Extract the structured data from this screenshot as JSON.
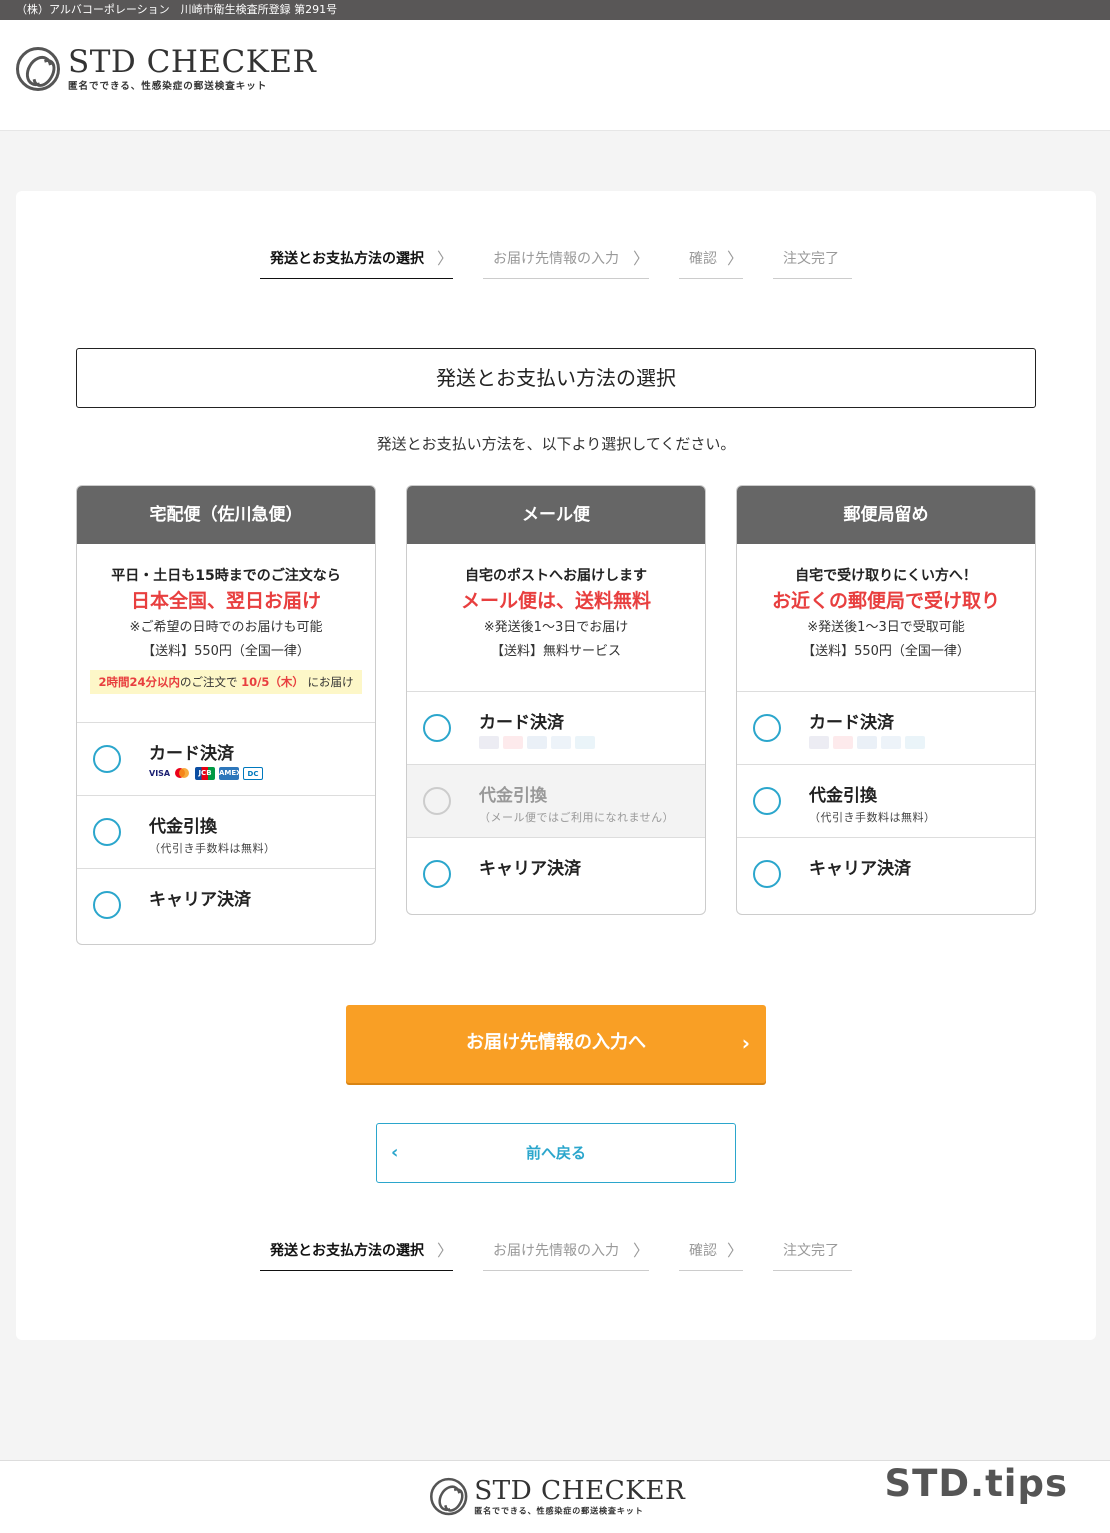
{
  "topbar": {
    "text": "（株）アルバコーポレーション　川崎市衛生検査所登録 第291号"
  },
  "brand": {
    "name": "STD CHECKER",
    "tagline": "匿名でできる、性感染症の郵送検査キット"
  },
  "steps": [
    {
      "label": "発送とお支払方法の選択",
      "active": true
    },
    {
      "label": "お届け先情報の入力",
      "active": false
    },
    {
      "label": "確認",
      "active": false
    },
    {
      "label": "注文完了",
      "active": false
    }
  ],
  "section": {
    "title": "発送とお支払い方法の選択",
    "lead": "発送とお支払い方法を、以下より選択してください。"
  },
  "plans": [
    {
      "title": "宅配便（佐川急便）",
      "line1": "平日・土日も15時までのご注文なら",
      "line2": "日本全国、翌日お届け",
      "line3": "※ご希望の日時でのお届けも可能",
      "line4": "【送料】550円（全国一律）",
      "promo": {
        "prefix": "2時間24分以内",
        "mid": "のご注文で",
        "date": "10/5（木）",
        "suffix": "にお届け"
      },
      "options": [
        {
          "label": "カード決済",
          "note": "",
          "cards": true
        },
        {
          "label": "代金引換",
          "note": "（代引き手数料は無料）"
        },
        {
          "label": "キャリア決済",
          "note": ""
        }
      ]
    },
    {
      "title": "メール便",
      "line1": "自宅のポストへお届けします",
      "line2": "メール便は、送料無料",
      "line3": "※発送後1〜3日でお届け",
      "line4": "【送料】無料サービス",
      "options": [
        {
          "label": "カード決済",
          "note": "",
          "cards": true
        },
        {
          "label": "代金引換",
          "note": "（メール便ではご利用になれません）",
          "disabled": true
        },
        {
          "label": "キャリア決済",
          "note": ""
        }
      ]
    },
    {
      "title": "郵便局留め",
      "line1": "自宅で受け取りにくい方へ！",
      "line2": "お近くの郵便局で受け取り",
      "line3": "※発送後1〜3日で受取可能",
      "line4": "【送料】550円（全国一律）",
      "options": [
        {
          "label": "カード決済",
          "note": "",
          "cards": true
        },
        {
          "label": "代金引換",
          "note": "（代引き手数料は無料）"
        },
        {
          "label": "キャリア決済",
          "note": ""
        }
      ]
    }
  ],
  "card_brands": [
    "VISA",
    "MC",
    "JCB",
    "AMEX",
    "DC"
  ],
  "buttons": {
    "next": "お届け先情報の入力へ",
    "back": "前へ戻る"
  },
  "watermark": "STD.tips",
  "colors": {
    "accent": "#f99f25",
    "link": "#2ba6cc",
    "highlight": "#e83f3f",
    "header": "#666666"
  }
}
